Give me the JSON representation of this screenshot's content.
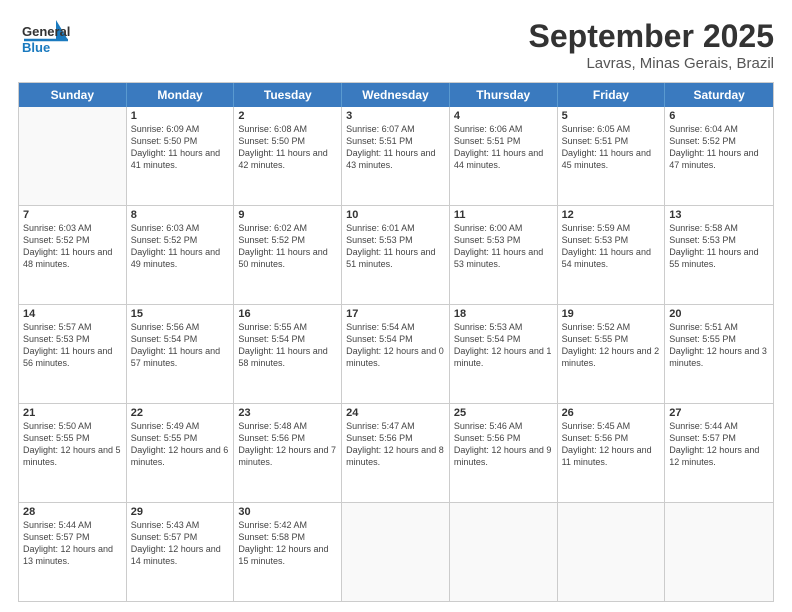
{
  "header": {
    "logo_line1": "General",
    "logo_line2": "Blue",
    "title": "September 2025",
    "subtitle": "Lavras, Minas Gerais, Brazil"
  },
  "days_of_week": [
    "Sunday",
    "Monday",
    "Tuesday",
    "Wednesday",
    "Thursday",
    "Friday",
    "Saturday"
  ],
  "weeks": [
    [
      {
        "day": "",
        "sunrise": "",
        "sunset": "",
        "daylight": ""
      },
      {
        "day": "1",
        "sunrise": "Sunrise: 6:09 AM",
        "sunset": "Sunset: 5:50 PM",
        "daylight": "Daylight: 11 hours and 41 minutes."
      },
      {
        "day": "2",
        "sunrise": "Sunrise: 6:08 AM",
        "sunset": "Sunset: 5:50 PM",
        "daylight": "Daylight: 11 hours and 42 minutes."
      },
      {
        "day": "3",
        "sunrise": "Sunrise: 6:07 AM",
        "sunset": "Sunset: 5:51 PM",
        "daylight": "Daylight: 11 hours and 43 minutes."
      },
      {
        "day": "4",
        "sunrise": "Sunrise: 6:06 AM",
        "sunset": "Sunset: 5:51 PM",
        "daylight": "Daylight: 11 hours and 44 minutes."
      },
      {
        "day": "5",
        "sunrise": "Sunrise: 6:05 AM",
        "sunset": "Sunset: 5:51 PM",
        "daylight": "Daylight: 11 hours and 45 minutes."
      },
      {
        "day": "6",
        "sunrise": "Sunrise: 6:04 AM",
        "sunset": "Sunset: 5:52 PM",
        "daylight": "Daylight: 11 hours and 47 minutes."
      }
    ],
    [
      {
        "day": "7",
        "sunrise": "Sunrise: 6:03 AM",
        "sunset": "Sunset: 5:52 PM",
        "daylight": "Daylight: 11 hours and 48 minutes."
      },
      {
        "day": "8",
        "sunrise": "Sunrise: 6:03 AM",
        "sunset": "Sunset: 5:52 PM",
        "daylight": "Daylight: 11 hours and 49 minutes."
      },
      {
        "day": "9",
        "sunrise": "Sunrise: 6:02 AM",
        "sunset": "Sunset: 5:52 PM",
        "daylight": "Daylight: 11 hours and 50 minutes."
      },
      {
        "day": "10",
        "sunrise": "Sunrise: 6:01 AM",
        "sunset": "Sunset: 5:53 PM",
        "daylight": "Daylight: 11 hours and 51 minutes."
      },
      {
        "day": "11",
        "sunrise": "Sunrise: 6:00 AM",
        "sunset": "Sunset: 5:53 PM",
        "daylight": "Daylight: 11 hours and 53 minutes."
      },
      {
        "day": "12",
        "sunrise": "Sunrise: 5:59 AM",
        "sunset": "Sunset: 5:53 PM",
        "daylight": "Daylight: 11 hours and 54 minutes."
      },
      {
        "day": "13",
        "sunrise": "Sunrise: 5:58 AM",
        "sunset": "Sunset: 5:53 PM",
        "daylight": "Daylight: 11 hours and 55 minutes."
      }
    ],
    [
      {
        "day": "14",
        "sunrise": "Sunrise: 5:57 AM",
        "sunset": "Sunset: 5:53 PM",
        "daylight": "Daylight: 11 hours and 56 minutes."
      },
      {
        "day": "15",
        "sunrise": "Sunrise: 5:56 AM",
        "sunset": "Sunset: 5:54 PM",
        "daylight": "Daylight: 11 hours and 57 minutes."
      },
      {
        "day": "16",
        "sunrise": "Sunrise: 5:55 AM",
        "sunset": "Sunset: 5:54 PM",
        "daylight": "Daylight: 11 hours and 58 minutes."
      },
      {
        "day": "17",
        "sunrise": "Sunrise: 5:54 AM",
        "sunset": "Sunset: 5:54 PM",
        "daylight": "Daylight: 12 hours and 0 minutes."
      },
      {
        "day": "18",
        "sunrise": "Sunrise: 5:53 AM",
        "sunset": "Sunset: 5:54 PM",
        "daylight": "Daylight: 12 hours and 1 minute."
      },
      {
        "day": "19",
        "sunrise": "Sunrise: 5:52 AM",
        "sunset": "Sunset: 5:55 PM",
        "daylight": "Daylight: 12 hours and 2 minutes."
      },
      {
        "day": "20",
        "sunrise": "Sunrise: 5:51 AM",
        "sunset": "Sunset: 5:55 PM",
        "daylight": "Daylight: 12 hours and 3 minutes."
      }
    ],
    [
      {
        "day": "21",
        "sunrise": "Sunrise: 5:50 AM",
        "sunset": "Sunset: 5:55 PM",
        "daylight": "Daylight: 12 hours and 5 minutes."
      },
      {
        "day": "22",
        "sunrise": "Sunrise: 5:49 AM",
        "sunset": "Sunset: 5:55 PM",
        "daylight": "Daylight: 12 hours and 6 minutes."
      },
      {
        "day": "23",
        "sunrise": "Sunrise: 5:48 AM",
        "sunset": "Sunset: 5:56 PM",
        "daylight": "Daylight: 12 hours and 7 minutes."
      },
      {
        "day": "24",
        "sunrise": "Sunrise: 5:47 AM",
        "sunset": "Sunset: 5:56 PM",
        "daylight": "Daylight: 12 hours and 8 minutes."
      },
      {
        "day": "25",
        "sunrise": "Sunrise: 5:46 AM",
        "sunset": "Sunset: 5:56 PM",
        "daylight": "Daylight: 12 hours and 9 minutes."
      },
      {
        "day": "26",
        "sunrise": "Sunrise: 5:45 AM",
        "sunset": "Sunset: 5:56 PM",
        "daylight": "Daylight: 12 hours and 11 minutes."
      },
      {
        "day": "27",
        "sunrise": "Sunrise: 5:44 AM",
        "sunset": "Sunset: 5:57 PM",
        "daylight": "Daylight: 12 hours and 12 minutes."
      }
    ],
    [
      {
        "day": "28",
        "sunrise": "Sunrise: 5:44 AM",
        "sunset": "Sunset: 5:57 PM",
        "daylight": "Daylight: 12 hours and 13 minutes."
      },
      {
        "day": "29",
        "sunrise": "Sunrise: 5:43 AM",
        "sunset": "Sunset: 5:57 PM",
        "daylight": "Daylight: 12 hours and 14 minutes."
      },
      {
        "day": "30",
        "sunrise": "Sunrise: 5:42 AM",
        "sunset": "Sunset: 5:58 PM",
        "daylight": "Daylight: 12 hours and 15 minutes."
      },
      {
        "day": "",
        "sunrise": "",
        "sunset": "",
        "daylight": ""
      },
      {
        "day": "",
        "sunrise": "",
        "sunset": "",
        "daylight": ""
      },
      {
        "day": "",
        "sunrise": "",
        "sunset": "",
        "daylight": ""
      },
      {
        "day": "",
        "sunrise": "",
        "sunset": "",
        "daylight": ""
      }
    ]
  ]
}
